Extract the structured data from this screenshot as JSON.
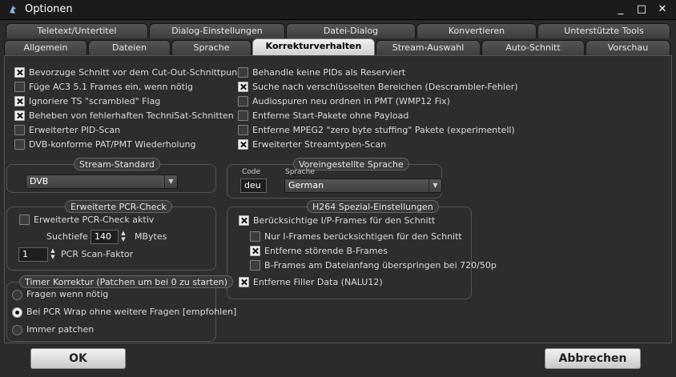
{
  "window": {
    "title": "Optionen",
    "minimize_glyph": "_",
    "maximize_glyph": "□",
    "close_glyph": "✕"
  },
  "tabs_row1": [
    "Teletext/Untertitel",
    "Dialog-Einstellungen",
    "Datei-Dialog",
    "Konvertieren",
    "Unterstützte Tools"
  ],
  "tabs_row2": [
    "Allgemein",
    "Dateien",
    "Sprache",
    "Korrekturverhalten",
    "Stream-Auswahl",
    "Auto-Schnitt",
    "Vorschau"
  ],
  "active_tab": "Korrekturverhalten",
  "left_options": [
    {
      "label": "Bevorzuge Schnitt vor dem Cut-Out-Schnittpunkt",
      "checked": true
    },
    {
      "label": "Füge AC3 5.1 Frames ein, wenn nötig",
      "checked": false
    },
    {
      "label": "Ignoriere TS \"scrambled\" Flag",
      "checked": true
    },
    {
      "label": "Beheben von fehlerhaften TechniSat-Schnitten",
      "checked": true
    },
    {
      "label": "Erweiterter PID-Scan",
      "checked": false
    },
    {
      "label": "DVB-konforme PAT/PMT Wiederholung",
      "checked": false
    }
  ],
  "right_options": [
    {
      "label": "Behandle keine PIDs als Reserviert",
      "checked": false
    },
    {
      "label": "Suche nach verschlüsselten Bereichen (Descrambler-Fehler)",
      "checked": true
    },
    {
      "label": "Audiospuren neu ordnen in PMT (WMP12 Fix)",
      "checked": false
    },
    {
      "label": "Entferne Start-Pakete ohne Payload",
      "checked": false
    },
    {
      "label": "Entferne MPEG2 \"zero byte stuffing\" Pakete (experimentell)",
      "checked": false
    },
    {
      "label": "Erweiterter Streamtypen-Scan",
      "checked": true
    }
  ],
  "stream_standard": {
    "title": "Stream-Standard",
    "value": "DVB"
  },
  "default_language": {
    "title": "Voreingestellte Sprache",
    "code_label": "Code",
    "code_value": "deu",
    "language_label": "Sprache",
    "language_value": "German"
  },
  "pcr": {
    "title": "Erweiterte PCR-Check",
    "active_label": "Erweiterte PCR-Check aktiv",
    "active_checked": false,
    "depth_label": "Suchtiefe",
    "depth_value": "140",
    "depth_unit": "MBytes",
    "factor_value": "1",
    "factor_label": "PCR Scan-Faktor"
  },
  "h264": {
    "title": "H264 Spezial-Einstellungen",
    "options": [
      {
        "label": "Berücksichtige I/P-Frames für den Schnitt",
        "checked": true
      },
      {
        "label": "Nur I-Frames berücksichtigen für den Schnitt",
        "checked": false
      },
      {
        "label": "Entferne störende B-Frames",
        "checked": true
      },
      {
        "label": "B-Frames am Dateianfang überspringen bei 720/50p",
        "checked": false
      },
      {
        "label": "Entferne Filler Data (NALU12)",
        "checked": true
      }
    ]
  },
  "timer": {
    "title": "Timer Korrektur (Patchen um bei 0 zu starten)",
    "options": [
      {
        "label": "Fragen wenn nötig",
        "selected": false
      },
      {
        "label": "Bei PCR Wrap ohne weitere Fragen [empfohlen]",
        "selected": true
      },
      {
        "label": "Immer patchen",
        "selected": false
      }
    ]
  },
  "buttons": {
    "ok": "OK",
    "cancel": "Abbrechen"
  }
}
